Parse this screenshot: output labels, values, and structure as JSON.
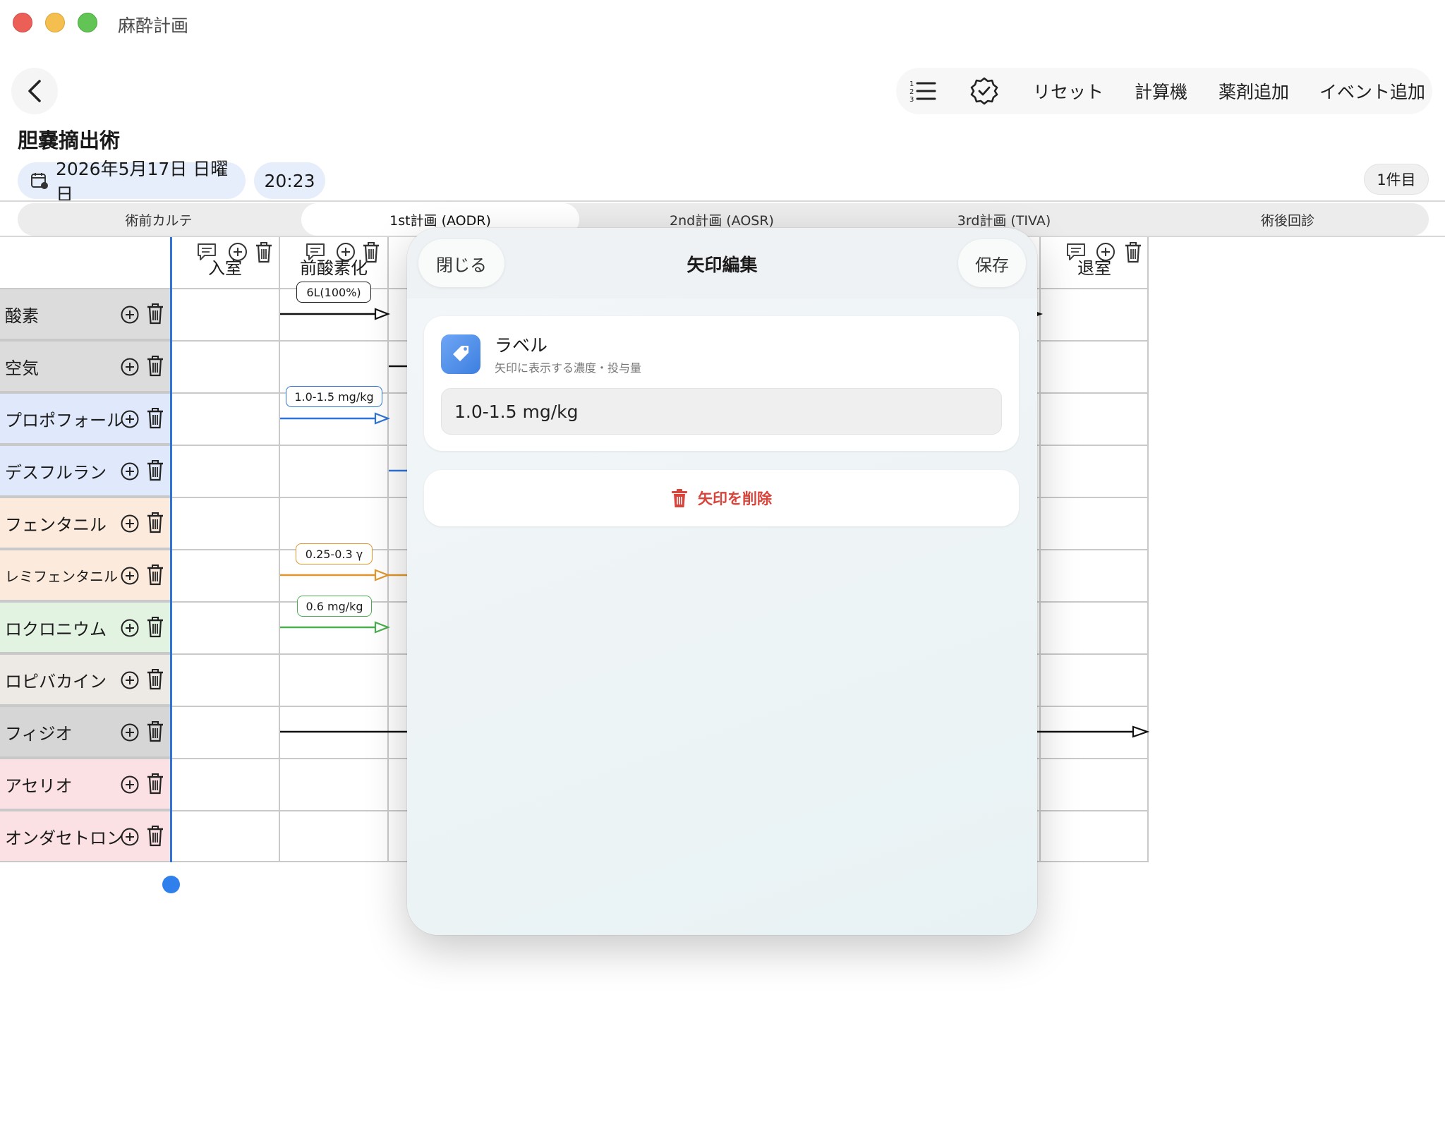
{
  "window": {
    "title": "麻酔計画"
  },
  "toolbar": {
    "reset": "リセット",
    "calculator": "計算機",
    "add_drug": "薬剤追加",
    "add_event": "イベント追加"
  },
  "page": {
    "title": "胆嚢摘出術"
  },
  "header": {
    "date": "2026年5月17日 日曜日",
    "time": "20:23",
    "count": "1件目"
  },
  "tabs": [
    "術前カルテ",
    "1st計画 (AODR)",
    "2nd計画 (AOSR)",
    "3rd計画 (TIVA)",
    "術後回診"
  ],
  "columns": [
    "入室",
    "前酸素化",
    "退室"
  ],
  "drugs": [
    {
      "name": "酸素",
      "color": "#dcdcdc"
    },
    {
      "name": "空気",
      "color": "#dcdcdc"
    },
    {
      "name": "プロポフォール",
      "color": "#e0e9fb"
    },
    {
      "name": "デスフルラン",
      "color": "#e0e9fb"
    },
    {
      "name": "フェンタニル",
      "color": "#fcebdc"
    },
    {
      "name": "レミフェンタニル",
      "color": "#fcebdc"
    },
    {
      "name": "ロクロニウム",
      "color": "#e3f3e1"
    },
    {
      "name": "ロピバカイン",
      "color": "#ede9e4"
    },
    {
      "name": "フィジオ",
      "color": "#d6d6d6"
    },
    {
      "name": "アセリオ",
      "color": "#fbe1e3"
    },
    {
      "name": "オンダセトロン",
      "color": "#fbe1e3"
    }
  ],
  "arrow_labels": {
    "oxygen": "6L(100%)",
    "propofol": "1.0-1.5 mg/kg",
    "remifentanil": "0.25-0.3 γ",
    "rocuronium": "0.6 mg/kg"
  },
  "colors": {
    "oxygen": "#111111",
    "propofol": "#2f74d8",
    "remifentanil": "#e0962c",
    "rocuronium": "#4caf50",
    "physio": "#111111",
    "accent": "#2f80ed",
    "danger": "#d9433a"
  },
  "modal": {
    "close": "閉じる",
    "title": "矢印編集",
    "save": "保存",
    "label_title": "ラベル",
    "label_subtitle": "矢印に表示する濃度・投与量",
    "label_value": "1.0-1.5 mg/kg",
    "delete": "矢印を削除"
  }
}
